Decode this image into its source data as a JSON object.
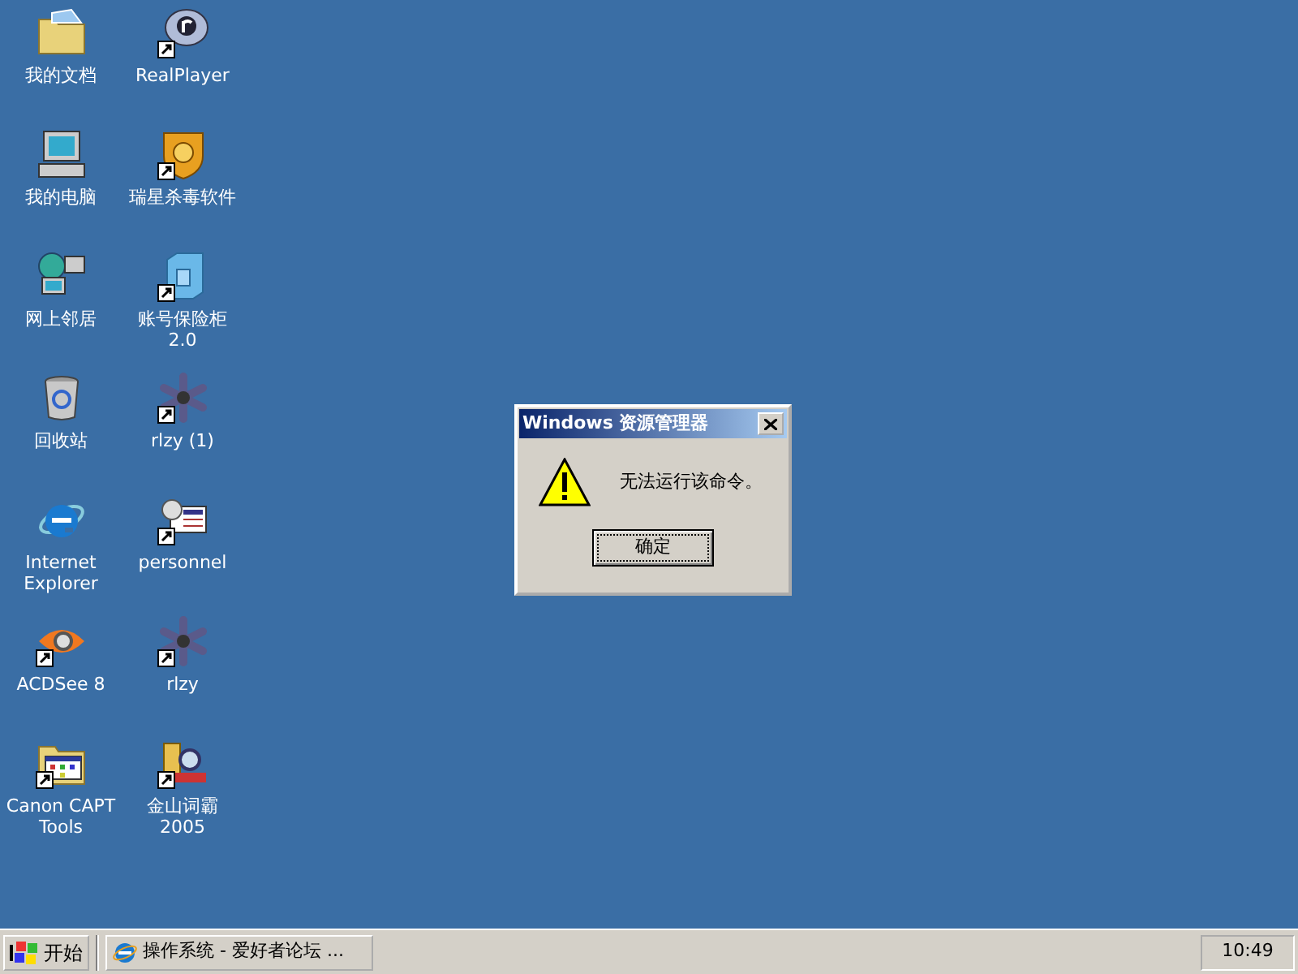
{
  "desktop_icons": [
    {
      "label": "我的文档",
      "kind": "folder",
      "shortcut": false
    },
    {
      "label": "RealPlayer",
      "kind": "disc",
      "shortcut": true
    },
    {
      "label": "我的电脑",
      "kind": "computer",
      "shortcut": false
    },
    {
      "label": "瑞星杀毒软件",
      "kind": "shield",
      "shortcut": true
    },
    {
      "label": "网上邻居",
      "kind": "network",
      "shortcut": false
    },
    {
      "label": "账号保险柜2.0",
      "kind": "safe",
      "shortcut": true
    },
    {
      "label": "回收站",
      "kind": "bin",
      "shortcut": false
    },
    {
      "label": "rlzy (1)",
      "kind": "gear",
      "shortcut": true
    },
    {
      "label": "Internet Explorer",
      "kind": "browser",
      "shortcut": false
    },
    {
      "label": "personnel",
      "kind": "card",
      "shortcut": true
    },
    {
      "label": "ACDSee 8",
      "kind": "eye",
      "shortcut": true
    },
    {
      "label": "rlzy",
      "kind": "gear",
      "shortcut": true
    },
    {
      "label": "Canon CAPT Tools",
      "kind": "folder-app",
      "shortcut": true
    },
    {
      "label": "金山词霸2005",
      "kind": "book",
      "shortcut": true
    }
  ],
  "dialog": {
    "title": "Windows 资源管理器",
    "message": "无法运行该命令。",
    "button": "确定"
  },
  "taskbar": {
    "start": "开始",
    "tasks": [
      {
        "label": "操作系统 - 爱好者论坛 ...",
        "selected": false
      }
    ],
    "clock": "10:49"
  }
}
